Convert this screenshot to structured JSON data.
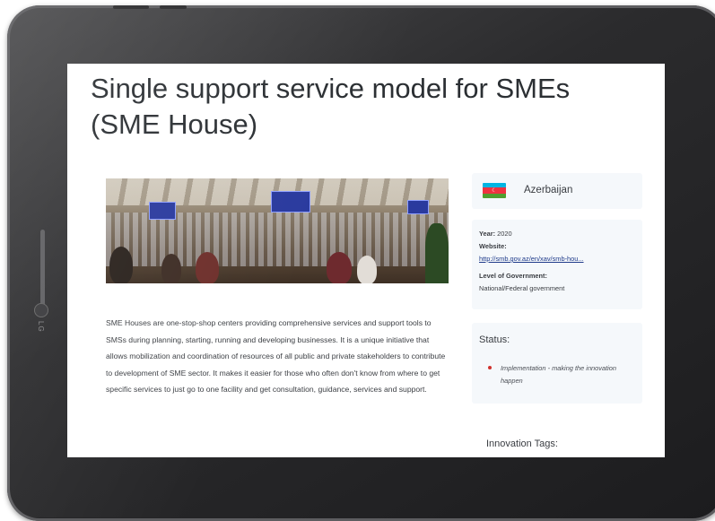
{
  "page": {
    "title": "Single support service model for SMEs (SME House)",
    "description": "SME Houses are one-stop-shop centers providing comprehensive services and support tools to SMSs during planning, starting, running and developing businesses. It is a unique initiative that allows mobilization and coordination of resources of all public and private stakeholders to contribute to development of SME sector. It makes it easier for those who often don't know from where to get specific services to just go to one facility and get consultation, guidance, services and support."
  },
  "country": {
    "name": "Azerbaijan",
    "flag_colors": [
      "#00b5e2",
      "#ef3340",
      "#509e2f"
    ],
    "flag_icon": "azerbaijan-flag-icon"
  },
  "info": {
    "year_label": "Year:",
    "year_value": "2020",
    "website_label": "Website:",
    "website_value": "http://smb.gov.az/en/xav/smb-hou...",
    "level_label": "Level of Government:",
    "level_value": "National/Federal government"
  },
  "status": {
    "title": "Status:",
    "item": "Implementation - making the innovation happen",
    "bullet_color": "#d0312d"
  },
  "tags": {
    "title": "Innovation Tags:"
  },
  "device": {
    "side_text": "LG"
  }
}
